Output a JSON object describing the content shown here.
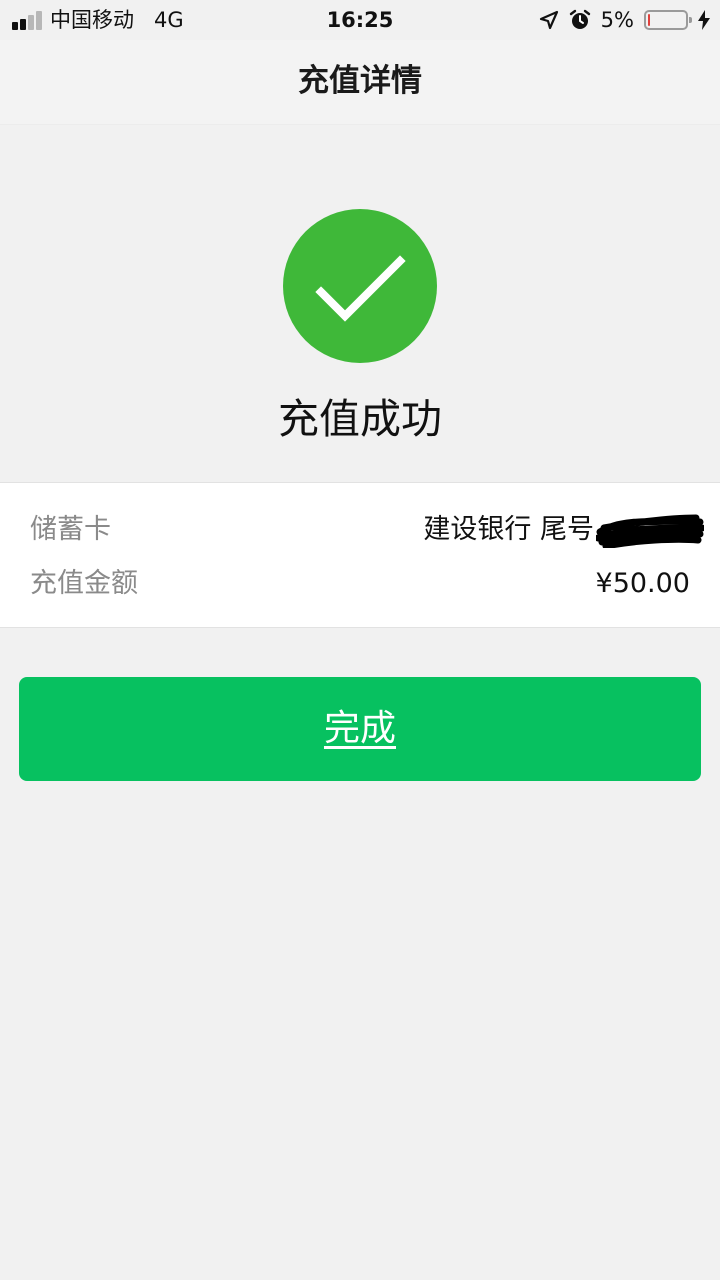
{
  "status_bar": {
    "carrier": "中国移动",
    "network": "4G",
    "time": "16:25",
    "battery_percent_text": "5%",
    "battery_level": 0.05,
    "icons": [
      "signal-icon",
      "location-arrow-icon",
      "alarm-icon",
      "battery-icon",
      "charging-bolt-icon"
    ]
  },
  "nav": {
    "title": "充值详情"
  },
  "result": {
    "icon": "checkmark-icon",
    "title": "充值成功",
    "accent_color": "#3fb839"
  },
  "details": {
    "rows": [
      {
        "label": "储蓄卡",
        "value": "建设银行 尾号"
      },
      {
        "label": "充值金额",
        "value": "¥50.00"
      }
    ]
  },
  "actions": {
    "done_label": "完成",
    "button_color": "#07c160"
  }
}
